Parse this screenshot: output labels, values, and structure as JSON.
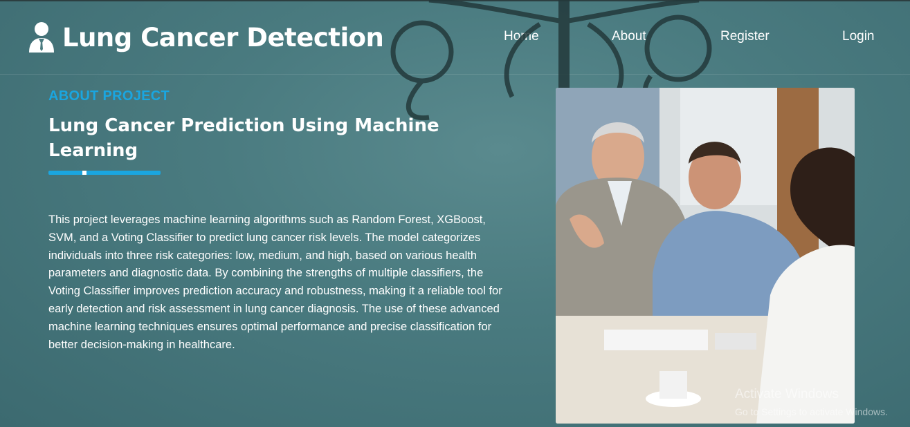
{
  "brand": {
    "title": "Lung Cancer Detection",
    "icon": "doctor-user-icon"
  },
  "nav": {
    "home": "Home",
    "about": "About",
    "register": "Register",
    "login": "Login"
  },
  "about": {
    "eyebrow": "ABOUT PROJECT",
    "heading": "Lung Cancer Prediction Using Machine Learning",
    "paragraph": "This project leverages machine learning algorithms such as Random Forest, XGBoost, SVM, and a Voting Classifier to predict lung cancer risk levels. The model categorizes individuals into three risk categories: low, medium, and high, based on various health parameters and diagnostic data. By combining the strengths of multiple classifiers, the Voting Classifier improves prediction accuracy and robustness, making it a reliable tool for early detection and risk assessment in lung cancer diagnosis. The use of these advanced machine learning techniques ensures optimal performance and precise classification for better decision-making in healthcare."
  },
  "watermark": {
    "title": "Activate Windows",
    "subtitle": "Go to Settings to activate Windows."
  },
  "colors": {
    "accent": "#1aa6e0",
    "background": "#4a7b80",
    "text": "#ffffff"
  }
}
